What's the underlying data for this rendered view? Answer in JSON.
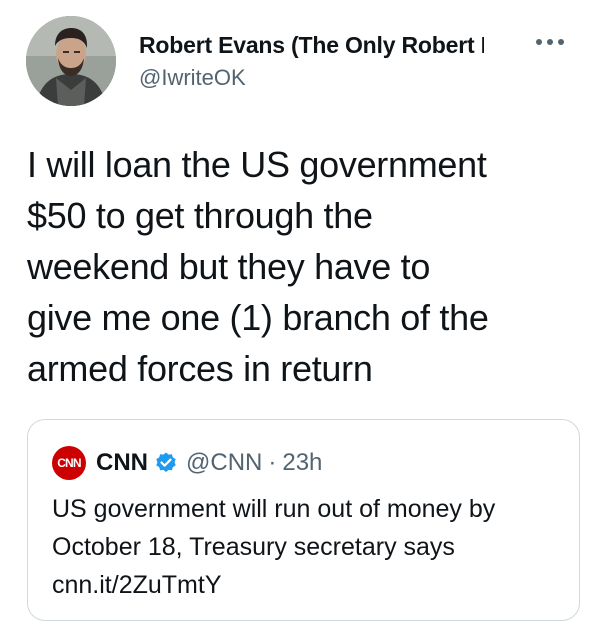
{
  "tweet": {
    "display_name": "Robert Evans (The Only Robert Evans)",
    "handle": "@IwriteOK",
    "more_label": "•••",
    "text_lines": [
      "I will loan the US government",
      "$50 to get through the",
      "weekend but they have to",
      "give me one (1) branch of the",
      "armed forces in return"
    ]
  },
  "quoted_tweet": {
    "logo_text": "CNN",
    "name": "CNN",
    "handle": "@CNN",
    "separator": "·",
    "time": "23h",
    "text_lines": [
      "US government will run out of money by",
      "October 18, Treasury secretary says",
      "cnn.it/2ZuTmtY"
    ]
  },
  "colors": {
    "text_primary": "#0f1419",
    "text_secondary": "#536471",
    "verified_blue": "#1d9bf0",
    "cnn_red": "#cc0000",
    "border": "#cfd9de"
  },
  "icons": {
    "more": "more-horizontal-icon",
    "verified": "verified-badge-icon"
  }
}
